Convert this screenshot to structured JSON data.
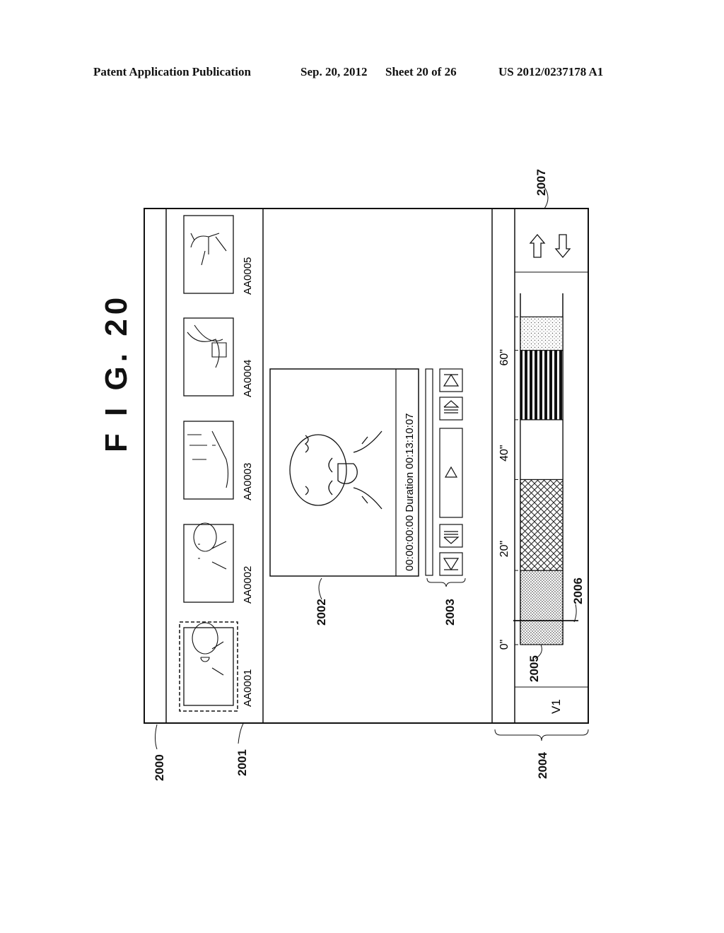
{
  "header": {
    "publication": "Patent Application Publication",
    "date": "Sep. 20, 2012",
    "sheet": "Sheet 20 of 26",
    "number": "US 2012/0237178 A1"
  },
  "figure": {
    "title": "F I G.  20",
    "refs": {
      "window": "2000",
      "thumbnail_strip": "2001",
      "preview": "2002",
      "controls": "2003",
      "timeline": "2004",
      "clip_segment": "2005",
      "playhead": "2006",
      "scroll_arrows": "2007"
    }
  },
  "thumbnails": [
    {
      "label": "AA0001",
      "kind": "face-smile",
      "selected": true
    },
    {
      "label": "AA0002",
      "kind": "face",
      "selected": false
    },
    {
      "label": "AA0003",
      "kind": "seascape",
      "selected": false
    },
    {
      "label": "AA0004",
      "kind": "landscape",
      "selected": false
    },
    {
      "label": "AA0005",
      "kind": "dog",
      "selected": false
    }
  ],
  "preview": {
    "timecode_text": "00:00:00:00 Duration 00:13:10:07"
  },
  "controls": {
    "buttons": [
      "skip-to-start",
      "step-back",
      "play",
      "step-forward",
      "skip-to-end"
    ],
    "progress": 0
  },
  "timeline": {
    "track_label": "V1",
    "ticks": [
      "0\"",
      "20\"",
      "40\"",
      "60\""
    ],
    "tick_seconds": [
      0,
      20,
      40,
      60
    ],
    "playhead_seconds": 5,
    "segments": [
      {
        "start": 0,
        "end": 15.5,
        "pattern": "dots"
      },
      {
        "start": 15.5,
        "end": 34.5,
        "pattern": "crosshatch"
      },
      {
        "start": 34.5,
        "end": 47,
        "pattern": "blank"
      },
      {
        "start": 47,
        "end": 61.5,
        "pattern": "vstripes"
      },
      {
        "start": 61.5,
        "end": 68.5,
        "pattern": "lightdots"
      }
    ]
  },
  "scroll": {
    "up": "arrow-up",
    "down": "arrow-down"
  }
}
